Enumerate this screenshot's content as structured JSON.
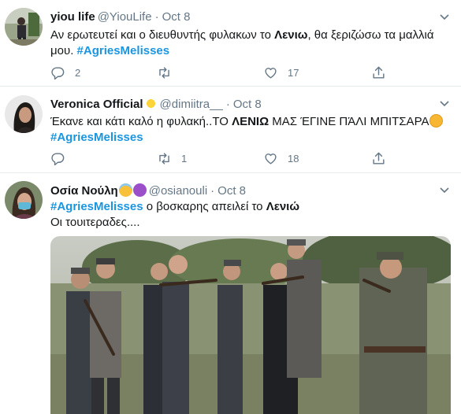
{
  "tweets": [
    {
      "name": "yiou life",
      "handle": "@YiouLife",
      "date": "Oct 8",
      "text_a": "Αν ερωτευτεί και ο διευθυντής  φυλακων το ",
      "text_bold": "Λενιω",
      "text_b": ", θα ξεριζώσω τα μαλλιά μου. ",
      "hashtag": "#AgriesMelisses",
      "replies": "2",
      "retweets": "",
      "likes": "17"
    },
    {
      "name": "Veronica Official",
      "handle": "@dimiitra__",
      "date": "Oct 8",
      "text_a": "Έκανε και κάτι καλό η φυλακή..ΤΟ ",
      "text_bold": "ΛΕΝΙΩ",
      "text_b": " ΜΑΣ ΈΓΙΝΕ ΠΆΛΙ ΜΠΙΤΣΑΡΑ",
      "hashtag": "#AgriesMelisses",
      "replies": "",
      "retweets": "1",
      "likes": "18"
    },
    {
      "name": "Οσία Νούλη",
      "handle": "@osianouli",
      "date": "Oct 8",
      "hashtag": "#AgriesMelisses",
      "text_a": " ο βοσκαρης απειλεί το ",
      "text_bold": "Λενιώ",
      "line2": "Οι τουιτεραδες...."
    }
  ],
  "icons": {
    "reply": "reply-icon",
    "retweet": "retweet-icon",
    "like": "heart-icon",
    "share": "share-icon",
    "caret": "chevron-down-icon"
  },
  "colors": {
    "link": "#1b95e0",
    "muted": "#657786",
    "divider": "#e6ecf0"
  }
}
